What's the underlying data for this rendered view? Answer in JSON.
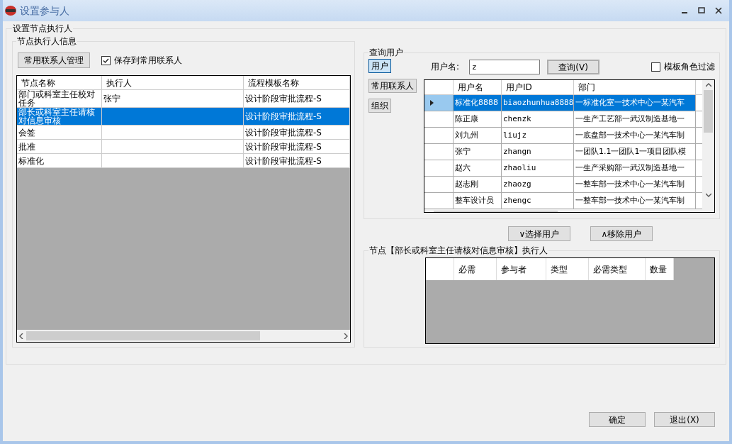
{
  "window": {
    "title": "设置参与人"
  },
  "outer_group": {
    "title": "设置节点执行人"
  },
  "executor_info": {
    "title": "节点执行人信息",
    "manage_button": "常用联系人管理",
    "save_checkbox": {
      "label": "保存到常用联系人",
      "checked": true
    },
    "table": {
      "columns": [
        "节点名称",
        "执行人",
        "流程模板名称"
      ],
      "rows": [
        {
          "cells": [
            "部门或科室主任校对任务",
            "张宁",
            "设计阶段审批流程-S"
          ],
          "selected": false
        },
        {
          "cells": [
            "部长或科室主任请核对信息审核",
            "",
            "设计阶段审批流程-S"
          ],
          "selected": true
        },
        {
          "cells": [
            "会签",
            "",
            "设计阶段审批流程-S"
          ],
          "selected": false
        },
        {
          "cells": [
            "批准",
            "",
            "设计阶段审批流程-S"
          ],
          "selected": false
        },
        {
          "cells": [
            "标准化",
            "",
            "设计阶段审批流程-S"
          ],
          "selected": false
        }
      ]
    }
  },
  "query_users": {
    "title": "查询用户",
    "side_buttons": [
      {
        "label": "用户",
        "selected": true
      },
      {
        "label": "常用联系人",
        "selected": false
      },
      {
        "label": "组织",
        "selected": false
      }
    ],
    "username_label": "用户名:",
    "username_field": {
      "value": "z"
    },
    "query_button": "查询(V)",
    "filter_checkbox": {
      "label": "模板角色过滤",
      "checked": false
    },
    "table": {
      "columns": [
        "",
        "用户名",
        "用户ID",
        "部门"
      ],
      "rows": [
        {
          "cells": [
            "",
            "标准化8888",
            "biaozhunhua8888",
            "一标准化室一技术中心一某汽车"
          ],
          "selected": true
        },
        {
          "cells": [
            "",
            "陈正康",
            "chenzk",
            "一生产工艺部一武汉制造基地一"
          ],
          "selected": false
        },
        {
          "cells": [
            "",
            "刘九州",
            "liujz",
            "一底盘部一技术中心一某汽车制"
          ],
          "selected": false
        },
        {
          "cells": [
            "",
            "张宁",
            "zhangn",
            "一团队1.1一团队1一项目团队模"
          ],
          "selected": false
        },
        {
          "cells": [
            "",
            "赵六",
            "zhaoliu",
            "一生产采购部一武汉制造基地一"
          ],
          "selected": false
        },
        {
          "cells": [
            "",
            "赵志刚",
            "zhaozg",
            "一整车部一技术中心一某汽车制"
          ],
          "selected": false
        },
        {
          "cells": [
            "",
            "整车设计员",
            "zhengc",
            "一整车部一技术中心一某汽车制"
          ],
          "selected": false
        }
      ]
    }
  },
  "select_button": "∨选择用户",
  "remove_button": "∧移除用户",
  "node_executors": {
    "title": "节点【部长或科室主任请核对信息审核】执行人",
    "columns": [
      "",
      "必需",
      "参与者",
      "类型",
      "必需类型",
      "数量"
    ]
  },
  "ok_button": "确定",
  "exit_button": "退出(X)"
}
